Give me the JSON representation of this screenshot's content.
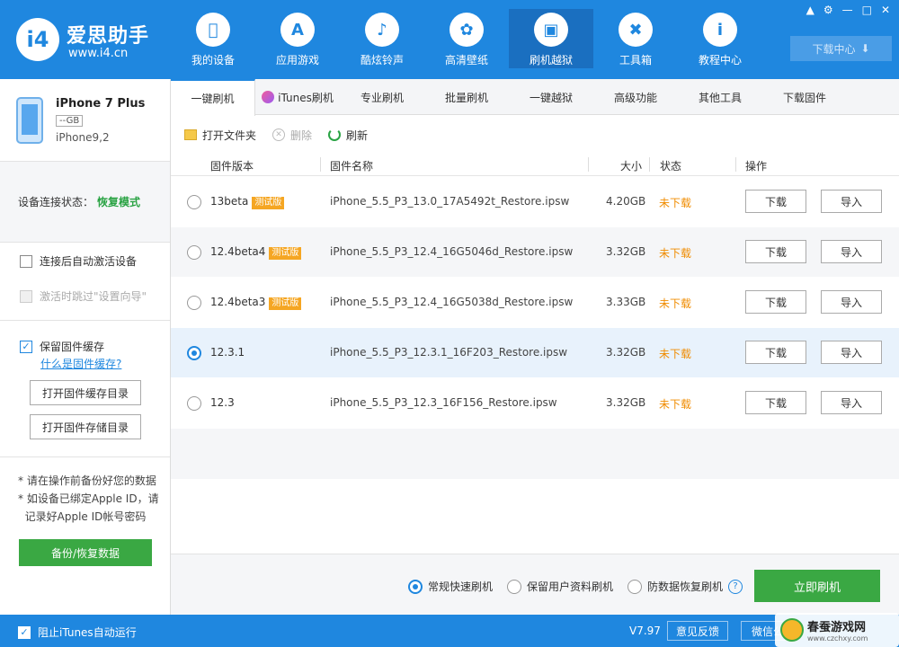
{
  "app": {
    "logo_text": "i4",
    "brand_name": "爱思助手",
    "brand_url": "www.i4.cn"
  },
  "nav": [
    {
      "label": "我的设备",
      "icon": "apple-icon",
      "active": false
    },
    {
      "label": "应用游戏",
      "icon": "app-store-icon",
      "active": false
    },
    {
      "label": "酷炫铃声",
      "icon": "bell-icon",
      "active": false
    },
    {
      "label": "高清壁纸",
      "icon": "flower-icon",
      "active": false
    },
    {
      "label": "刷机越狱",
      "icon": "box-icon",
      "active": true
    },
    {
      "label": "工具箱",
      "icon": "tools-icon",
      "active": false
    },
    {
      "label": "教程中心",
      "icon": "info-icon",
      "active": false
    }
  ],
  "window_controls": [
    "shirt-icon",
    "gear-icon",
    "minimize-icon",
    "maximize-icon",
    "close-icon"
  ],
  "download_center": {
    "label": "下载中心"
  },
  "device": {
    "name": "iPhone 7 Plus",
    "capacity": "--GB",
    "model": "iPhone9,2"
  },
  "connection": {
    "label": "设备连接状态：",
    "value": "恢复模式"
  },
  "options": {
    "auto_activate": {
      "label": "连接后自动激活设备",
      "checked": false
    },
    "skip_setup": {
      "label": "激活时跳过\"设置向导\"",
      "checked": false,
      "disabled": true
    },
    "keep_cache": {
      "label": "保留固件缓存",
      "checked": true
    },
    "cache_link": "什么是固件缓存?"
  },
  "left_buttons": {
    "open_cache_dir": "打开固件缓存目录",
    "open_store_dir": "打开固件存储目录",
    "backup": "备份/恢复数据"
  },
  "notes": [
    "* 请在操作前备份好您的数据",
    "* 如设备已绑定Apple ID，请",
    "  记录好Apple ID帐号密码"
  ],
  "tabs": [
    {
      "label": "一键刷机",
      "active": true
    },
    {
      "label": "iTunes刷机",
      "active": false,
      "icon": "itunes-icon"
    },
    {
      "label": "专业刷机",
      "active": false
    },
    {
      "label": "批量刷机",
      "active": false
    },
    {
      "label": "一键越狱",
      "active": false
    },
    {
      "label": "高级功能",
      "active": false
    },
    {
      "label": "其他工具",
      "active": false
    },
    {
      "label": "下载固件",
      "active": false
    }
  ],
  "toolbar": {
    "open_folder": "打开文件夹",
    "delete": "删除",
    "refresh": "刷新"
  },
  "table": {
    "headers": {
      "version": "固件版本",
      "name": "固件名称",
      "size": "大小",
      "status": "状态",
      "action": "操作"
    },
    "rows": [
      {
        "version": "13beta",
        "beta_badge": "测试版",
        "name": "iPhone_5.5_P3_13.0_17A5492t_Restore.ipsw",
        "size": "4.20GB",
        "status": "未下载",
        "selected": false,
        "download": "下载",
        "import": "导入"
      },
      {
        "version": "12.4beta4",
        "beta_badge": "测试版",
        "name": "iPhone_5.5_P3_12.4_16G5046d_Restore.ipsw",
        "size": "3.32GB",
        "status": "未下载",
        "selected": false,
        "download": "下载",
        "import": "导入"
      },
      {
        "version": "12.4beta3",
        "beta_badge": "测试版",
        "name": "iPhone_5.5_P3_12.4_16G5038d_Restore.ipsw",
        "size": "3.33GB",
        "status": "未下载",
        "selected": false,
        "download": "下载",
        "import": "导入"
      },
      {
        "version": "12.3.1",
        "beta_badge": "",
        "name": "iPhone_5.5_P3_12.3.1_16F203_Restore.ipsw",
        "size": "3.32GB",
        "status": "未下载",
        "selected": true,
        "download": "下载",
        "import": "导入"
      },
      {
        "version": "12.3",
        "beta_badge": "",
        "name": "iPhone_5.5_P3_12.3_16F156_Restore.ipsw",
        "size": "3.32GB",
        "status": "未下载",
        "selected": false,
        "download": "下载",
        "import": "导入"
      }
    ]
  },
  "flash_modes": [
    {
      "label": "常规快速刷机",
      "selected": true
    },
    {
      "label": "保留用户资料刷机",
      "selected": false
    },
    {
      "label": "防数据恢复刷机",
      "selected": false
    }
  ],
  "flash_button": "立即刷机",
  "statusbar": {
    "block_itunes": {
      "label": "阻止iTunes自动运行",
      "checked": true
    },
    "version": "V7.97",
    "feedback": "意见反馈",
    "wechat": "微信公"
  },
  "watermark": {
    "title": "春蚕游戏网",
    "url": "www.czchxy.com"
  },
  "colors": {
    "primary": "#1f87df",
    "success": "#3aa843",
    "warning": "#f08c00",
    "badge": "#f5a623"
  }
}
